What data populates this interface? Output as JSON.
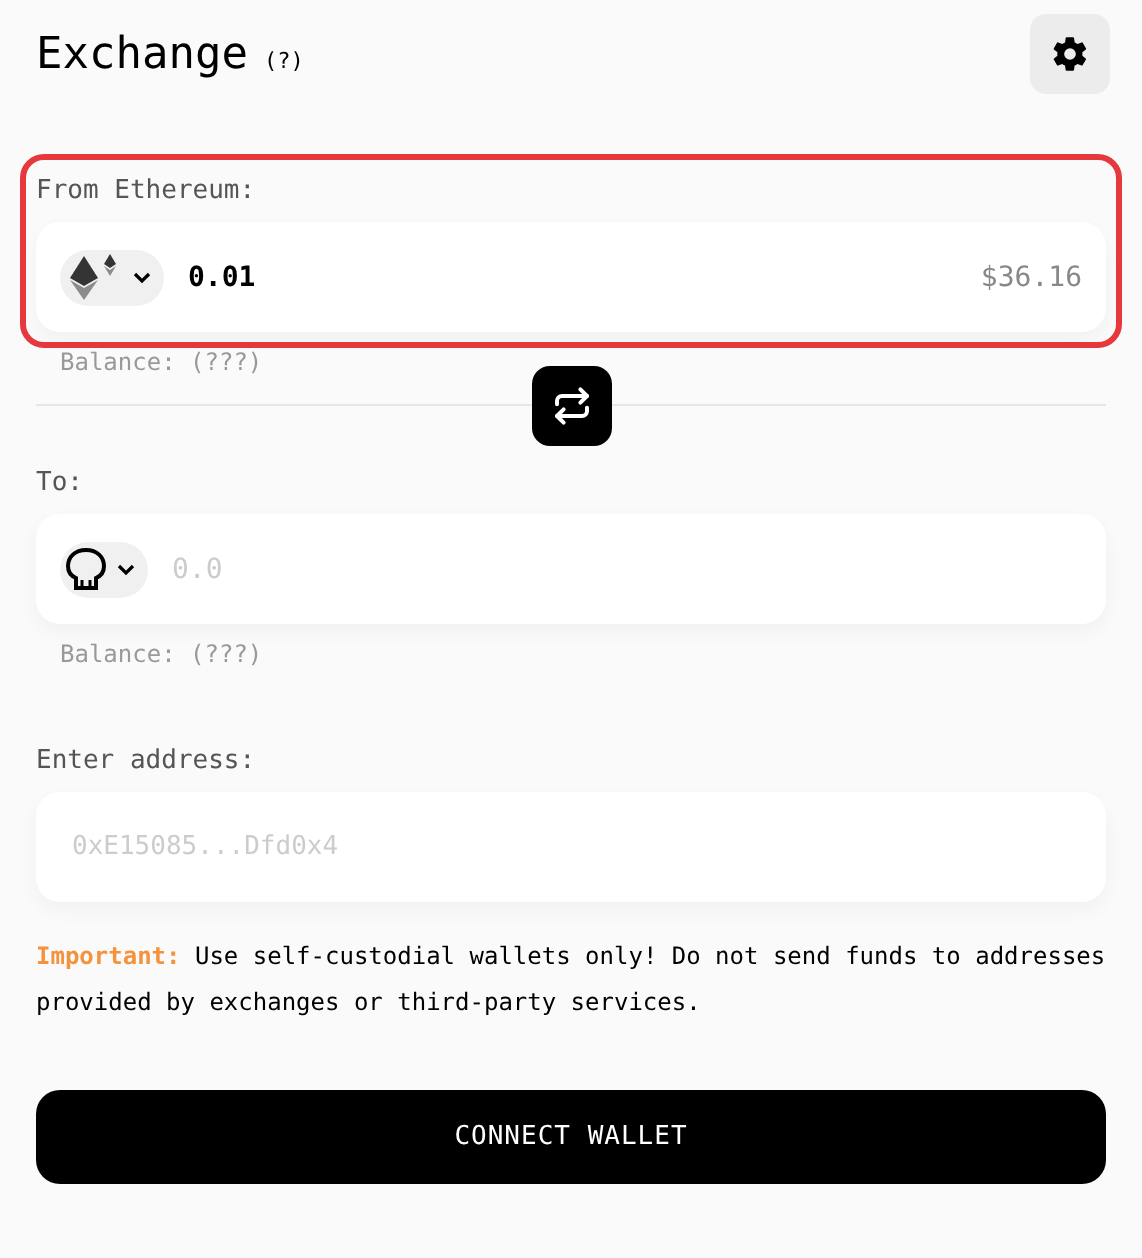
{
  "header": {
    "title": "Exchange",
    "help": "(?)"
  },
  "from": {
    "label": "From Ethereum:",
    "highlighted": true,
    "token": {
      "kind": "ethereum"
    },
    "value": "0.01",
    "fiat": "$36.16",
    "balance": "Balance: (???)"
  },
  "to": {
    "label": "To:",
    "token": {
      "kind": "skull"
    },
    "placeholder": "0.0",
    "balance": "Balance: (???)"
  },
  "address": {
    "label": "Enter address:",
    "placeholder": "0xE15085...Dfd0x4"
  },
  "notice": "**Important:** Use self-custodial wallets only! Do not send funds to addresses provided by exchanges or third-party services.",
  "button": "CONNECT WALLET"
}
